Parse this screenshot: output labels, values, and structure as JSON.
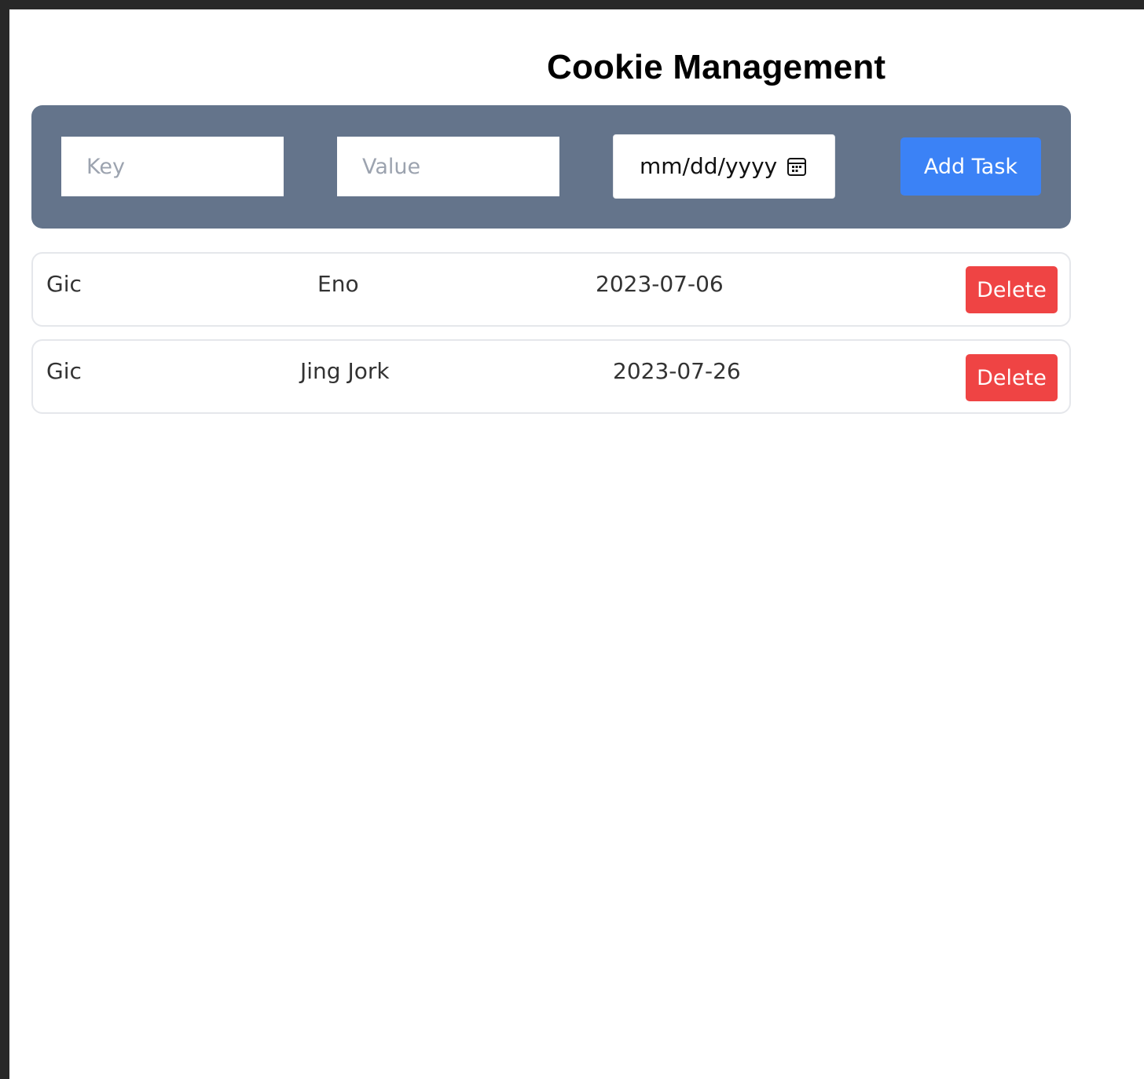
{
  "header": {
    "title": "Cookie Management"
  },
  "form": {
    "key_placeholder": "Key",
    "key_value": "",
    "value_placeholder": "Value",
    "value_value": "",
    "date_placeholder": "mm/dd/yyyy",
    "date_icon": "calendar-icon",
    "add_label": "Add Task",
    "panel_color": "#64748b",
    "add_color": "#3b82f6"
  },
  "cookies": [
    {
      "key": "Gic",
      "value": "Eno",
      "date": "2023-07-06",
      "delete_label": "Delete"
    },
    {
      "key": "Gic",
      "value": "Jing Jork",
      "date": "2023-07-26",
      "delete_label": "Delete"
    }
  ],
  "colors": {
    "delete": "#ef4444"
  }
}
